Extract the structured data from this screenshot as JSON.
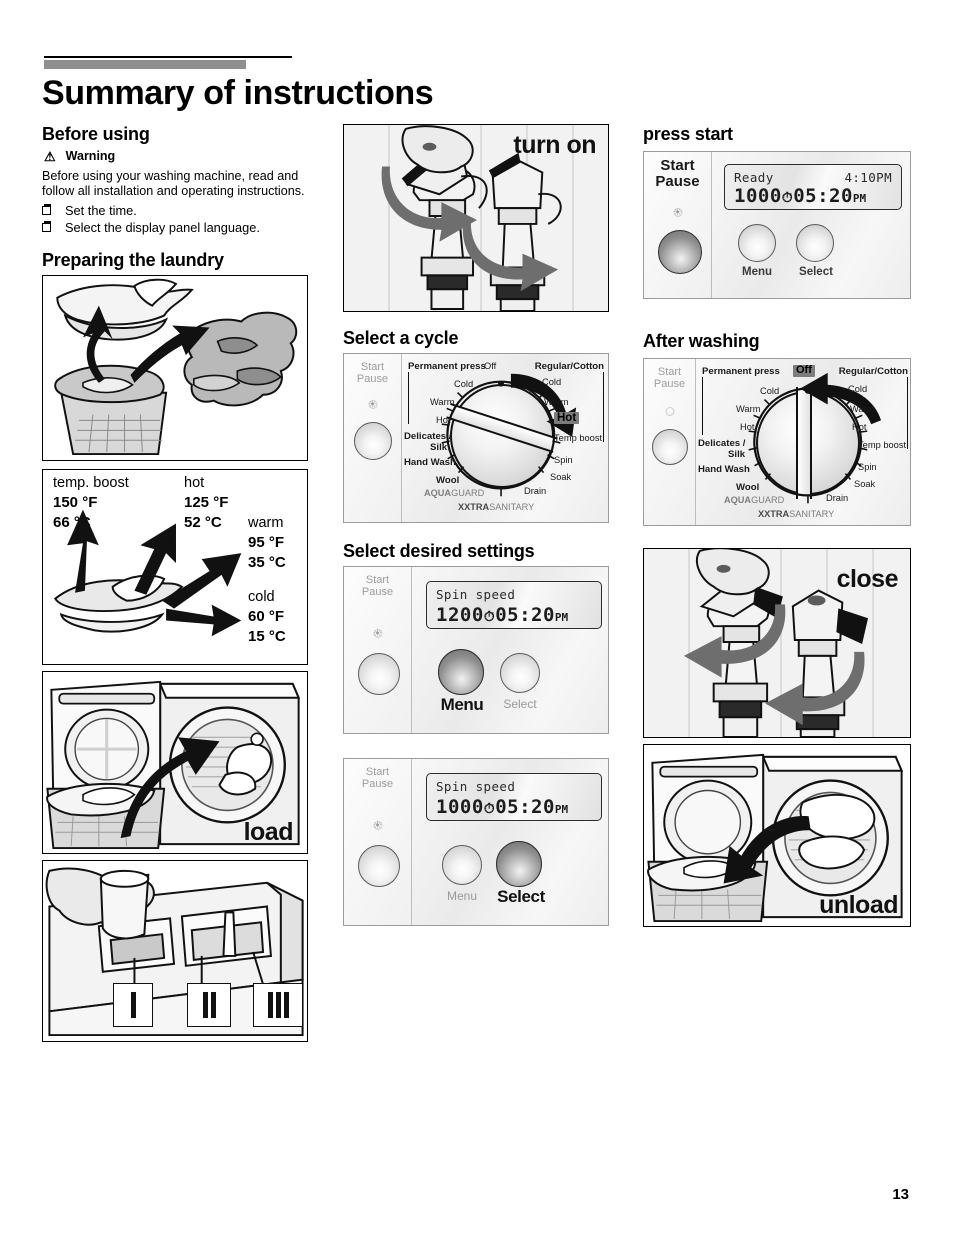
{
  "page": {
    "title": "Summary of instructions",
    "number": "13"
  },
  "left": {
    "before_using": {
      "heading": "Before using",
      "warning_label": "Warning",
      "warning_icon": "warning-triangle-icon",
      "body": "Before using your washing machine, read and follow all installation and operating instructions.",
      "checklist": [
        "Set the time.",
        "Select the display panel language."
      ]
    },
    "preparing": {
      "heading": "Preparing the laundry",
      "fig_sort_alt": "sorting laundry from basket into two piles"
    },
    "temperature": {
      "items": [
        {
          "name": "temp. boost",
          "f": "150 °F",
          "c": "66 °C"
        },
        {
          "name": "hot",
          "f": "125 °F",
          "c": "52 °C"
        },
        {
          "name": "warm",
          "f": "95 °F",
          "c": "35 °C"
        },
        {
          "name": "cold",
          "f": "60 °F",
          "c": "15 °C"
        }
      ]
    },
    "load_label": "load",
    "detergent": {
      "compartments": [
        "I",
        "II",
        "III"
      ]
    }
  },
  "middle": {
    "turn_on_label": "turn on",
    "select_cycle": {
      "heading": "Select a cycle"
    },
    "select_settings": {
      "heading": "Select desired settings"
    },
    "panel_menu": {
      "start_pause": "Start\nPause",
      "lcd_line1_left": "Spin speed",
      "lcd_line1_right": "",
      "lcd_value": "1200",
      "lcd_time": "05:20",
      "lcd_ampm": "PM",
      "menu_label": "Menu",
      "select_label": "Select"
    },
    "panel_select": {
      "start_pause": "Start\nPause",
      "lcd_line1_left": "Spin speed",
      "lcd_value": "1000",
      "lcd_time": "05:20",
      "lcd_ampm": "PM",
      "menu_label": "Menu",
      "select_label": "Select"
    }
  },
  "right": {
    "press_start": {
      "heading": "press start"
    },
    "after_washing": {
      "heading": "After washing"
    },
    "close_label": "close",
    "unload_label": "unload",
    "start_panel": {
      "start_pause_line1": "Start",
      "start_pause_line2": "Pause",
      "lcd_status": "Ready",
      "lcd_clock": "4:10PM",
      "lcd_value": "1000",
      "lcd_time": "05:20",
      "lcd_ampm": "PM",
      "menu_label": "Menu",
      "select_label": "Select"
    }
  },
  "dial": {
    "start_pause_line1": "Start",
    "start_pause_line2": "Pause",
    "off": "Off",
    "group_left": "Permanent press",
    "group_right": "Regular/Cotton",
    "left_temps": [
      "Cold",
      "Warm",
      "Hot"
    ],
    "right_temps": [
      "Cold",
      "Warm",
      "Hot",
      "Temp boost"
    ],
    "programs": [
      "Delicates /",
      "Silk",
      "Hand Wash",
      "Wool"
    ],
    "bottom_right": [
      "Spin",
      "Soak",
      "Drain"
    ],
    "brand1_a": "AQUA",
    "brand1_b": "GUARD",
    "brand2_a": "XXTRA",
    "brand2_b": "SANITARY",
    "selected_cycle": "Hot",
    "selected_after": "Off"
  },
  "colors": {
    "rule_gray": "#8f8f8f",
    "highlight": "#7c7c7c",
    "panel_bg": "#f1f1f1",
    "ink": "#000000"
  }
}
